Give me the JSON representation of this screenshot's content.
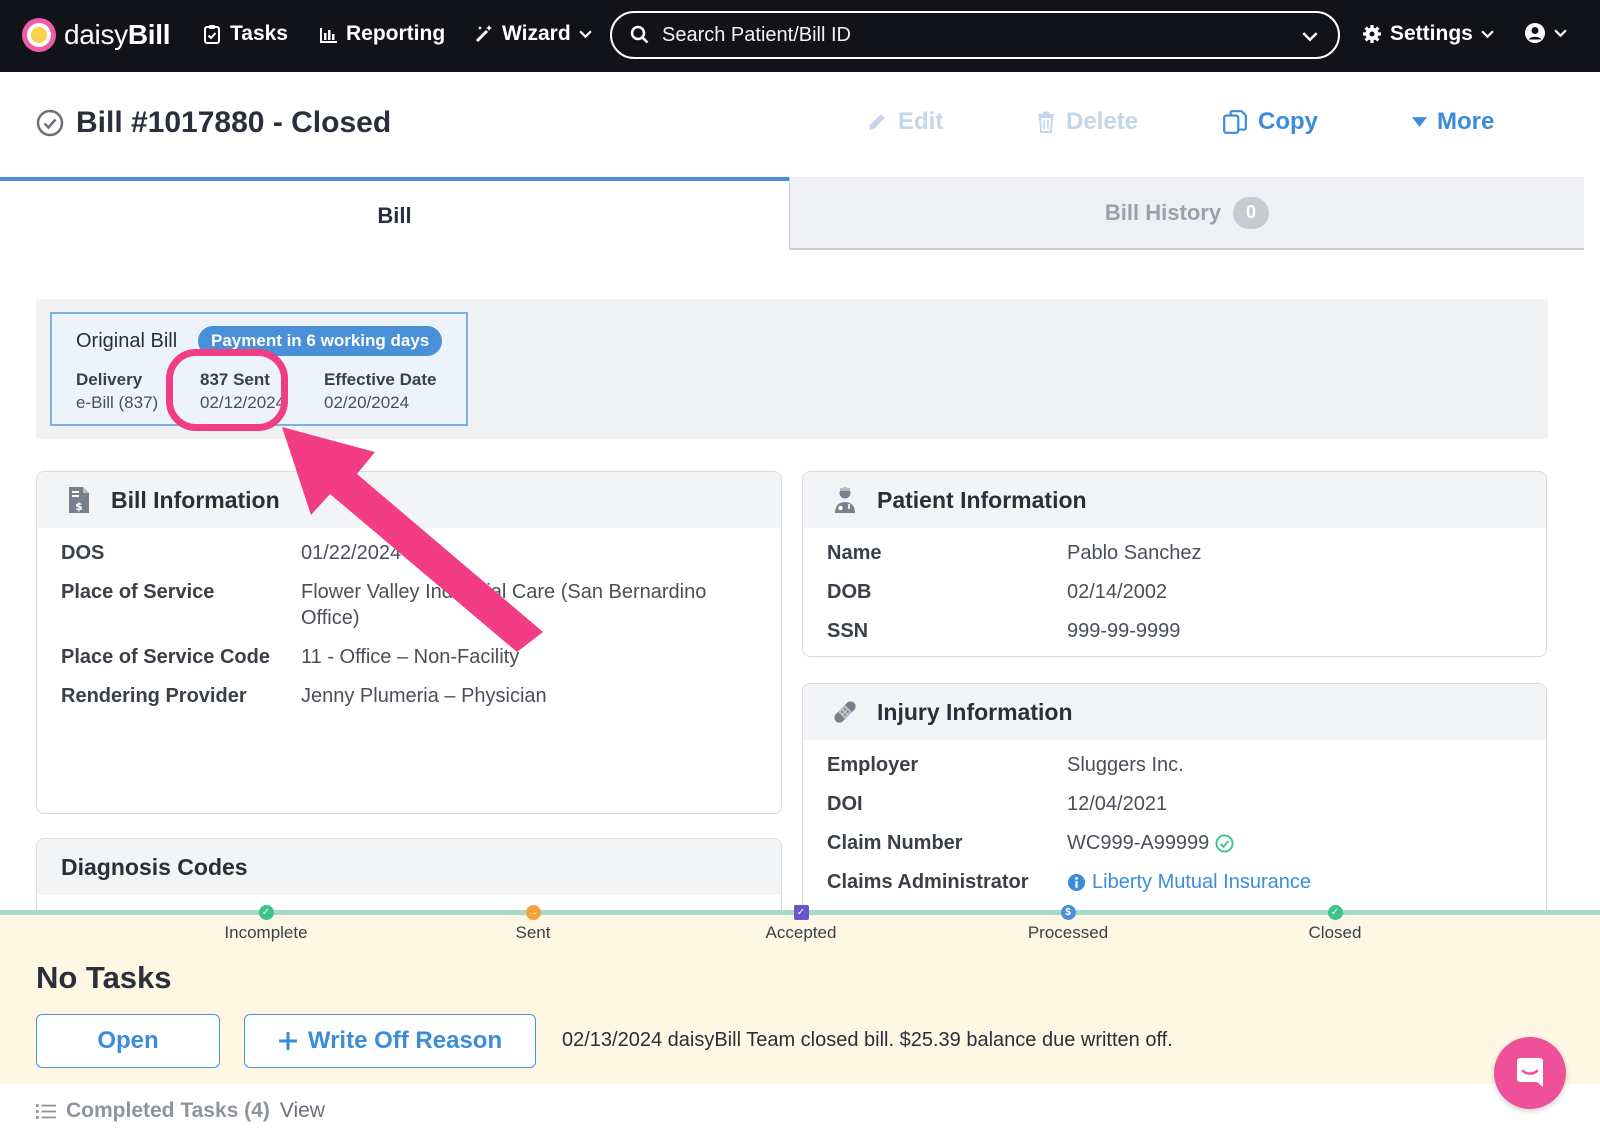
{
  "nav": {
    "brand_light": "daisy",
    "brand_bold": "Bill",
    "tasks": "Tasks",
    "reporting": "Reporting",
    "wizard": "Wizard",
    "search_placeholder": "Search Patient/Bill ID",
    "settings": "Settings"
  },
  "header": {
    "title": "Bill #1017880 - Closed",
    "edit": "Edit",
    "delete": "Delete",
    "copy": "Copy",
    "more": "More"
  },
  "tabs": {
    "bill": "Bill",
    "history": "Bill History",
    "history_count": "0"
  },
  "original_bill": {
    "title": "Original Bill",
    "badge": "Payment in 6 working days",
    "delivery_label": "Delivery",
    "delivery_value": "e-Bill (837)",
    "sent_label": "837 Sent",
    "sent_value": "02/12/2024",
    "effective_label": "Effective Date",
    "effective_value": "02/20/2024"
  },
  "bill_info": {
    "title": "Bill Information",
    "rows": [
      {
        "k": "DOS",
        "v": "01/22/2024"
      },
      {
        "k": "Place of Service",
        "v": "Flower Valley Industrial Care (San Bernardino",
        "v2": "Office)"
      },
      {
        "k": "Place of Service Code",
        "v": "11 - Office – Non-Facility"
      },
      {
        "k": "Rendering Provider",
        "v": "Jenny Plumeria – Physician"
      }
    ]
  },
  "patient_info": {
    "title": "Patient Information",
    "rows": [
      {
        "k": "Name",
        "v": "Pablo Sanchez"
      },
      {
        "k": "DOB",
        "v": "02/14/2002"
      },
      {
        "k": "SSN",
        "v": "999-99-9999"
      }
    ]
  },
  "injury_info": {
    "title": "Injury Information",
    "rows": [
      {
        "k": "Employer",
        "v": "Sluggers Inc."
      },
      {
        "k": "DOI",
        "v": "12/04/2021"
      },
      {
        "k": "Claim Number",
        "v": "WC999-A99999"
      },
      {
        "k": "Claims Administrator",
        "v": "Liberty Mutual Insurance"
      }
    ]
  },
  "diagnosis": {
    "title": "Diagnosis Codes"
  },
  "status_steps": [
    {
      "label": "Incomplete",
      "color": "#3cc48a",
      "icon": "check-icon"
    },
    {
      "label": "Sent",
      "color": "#f5a03a",
      "icon": "arrow-icon"
    },
    {
      "label": "Accepted",
      "color": "#6a55c9",
      "icon": "check-box-icon"
    },
    {
      "label": "Processed",
      "color": "#4a90d9",
      "icon": "dollar-icon"
    },
    {
      "label": "Closed",
      "color": "#3cc48a",
      "icon": "check-icon"
    }
  ],
  "tasks": {
    "heading": "No Tasks",
    "open_button": "Open",
    "write_off_button": "Write Off Reason",
    "note": "02/13/2024 daisyBill Team closed bill. $25.39 balance due written off.",
    "completed_label": "Completed Tasks (4)",
    "view": "View"
  },
  "colors": {
    "accent": "#4a90d9",
    "highlight": "#f23d85",
    "nav_bg": "#111318",
    "task_bg": "#fdf7e4"
  }
}
